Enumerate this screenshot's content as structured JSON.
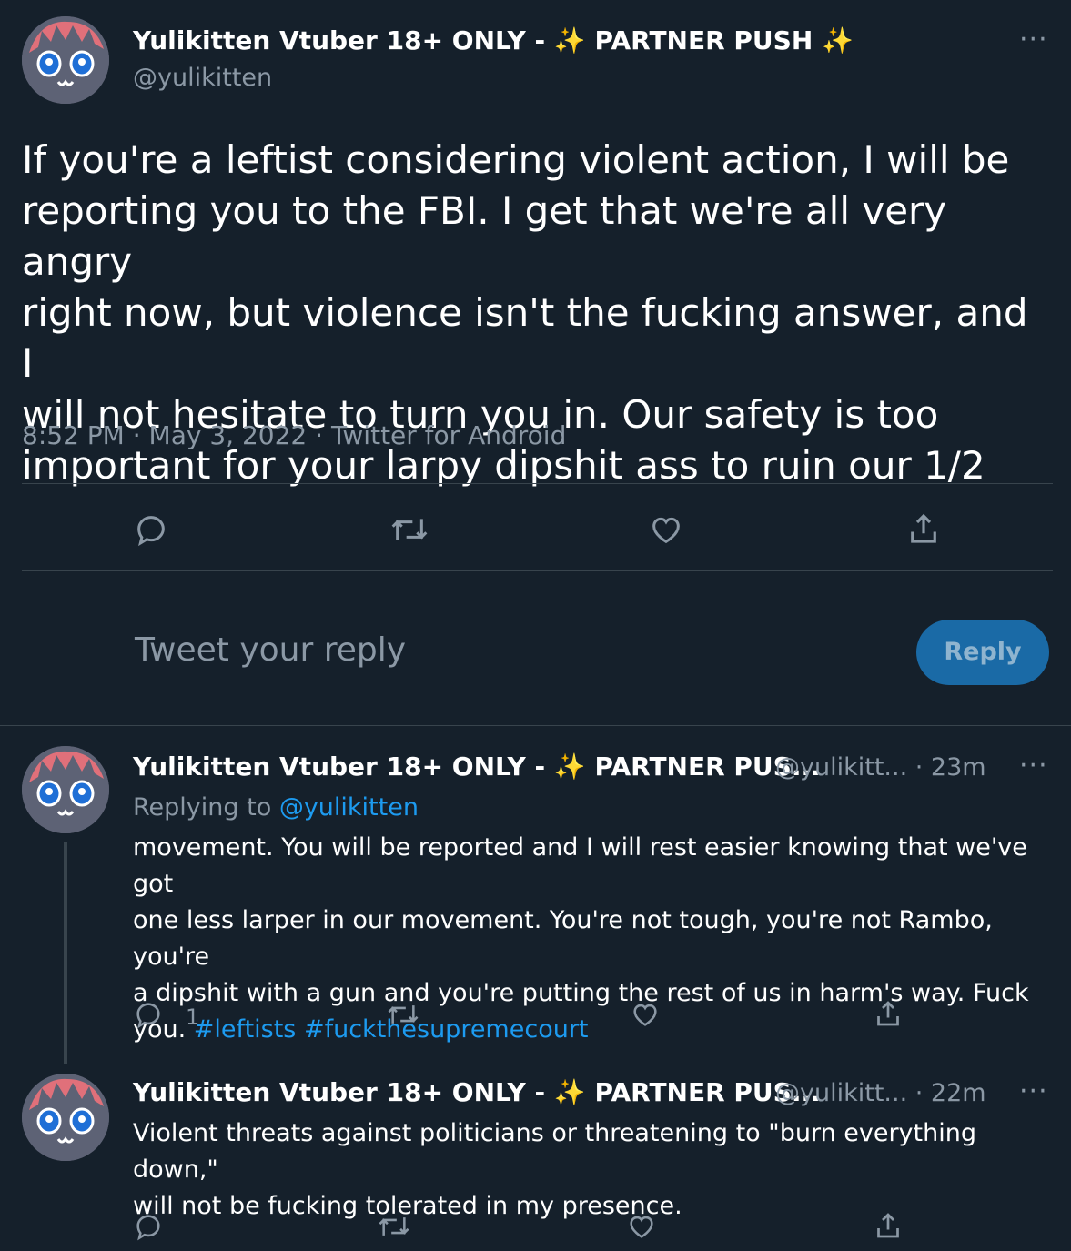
{
  "main_tweet": {
    "display_name": "Yulikitten Vtuber 18+ ONLY -",
    "name_suffix": "PARTNER PUSH",
    "sparkle": "✨",
    "handle": "@yulikitten",
    "more": "···",
    "text_lines": [
      "If you're a leftist considering violent action, I will be",
      "reporting you to the FBI. I get that we're all very angry",
      "right now, but violence isn't the fucking answer, and I",
      "will not hesitate to turn you in. Our safety is too",
      "important for your larpy dipshit ass to ruin our 1/2"
    ],
    "time": "8:52 PM",
    "sep": "·",
    "date": "May 3, 2022",
    "source": "Twitter for Android"
  },
  "reply_box": {
    "placeholder": "Tweet your reply",
    "button": "Reply"
  },
  "replies": [
    {
      "display_name": "Yulikitten Vtuber 18+ ONLY -",
      "name_suffix": "PARTNER PUS...",
      "handle": "@yulikitt...",
      "time": "· 23m",
      "replying_prefix": "Replying to",
      "replying_to": "@yulikitten",
      "text_lines": [
        "movement. You will be reported and I will rest easier knowing that we've got",
        "one less larper in our movement. You're not tough, you're not Rambo, you're",
        "a dipshit with a gun and you're putting the rest of us in harm's way. Fuck"
      ],
      "last_line_prefix": "you.",
      "hashtag1": "#leftists",
      "hashtag2": "#fuckthesupremecourt",
      "reply_count": "1"
    },
    {
      "display_name": "Yulikitten Vtuber 18+ ONLY -",
      "name_suffix": "PARTNER PUS...",
      "handle": "@yulikitt...",
      "time": "· 22m",
      "text_lines": [
        "Violent threats against politicians or threatening to \"burn everything down,\"",
        "will not be fucking tolerated in my presence."
      ]
    }
  ],
  "colors": {
    "background": "#15202b",
    "text": "#ffffff",
    "secondary": "#8b98a5",
    "link": "#1d9bf0",
    "divider": "#38444d",
    "reply_button": "#1a6aa6"
  },
  "icons": [
    "reply-icon",
    "retweet-icon",
    "like-icon",
    "share-icon",
    "more-icon",
    "avatar"
  ]
}
